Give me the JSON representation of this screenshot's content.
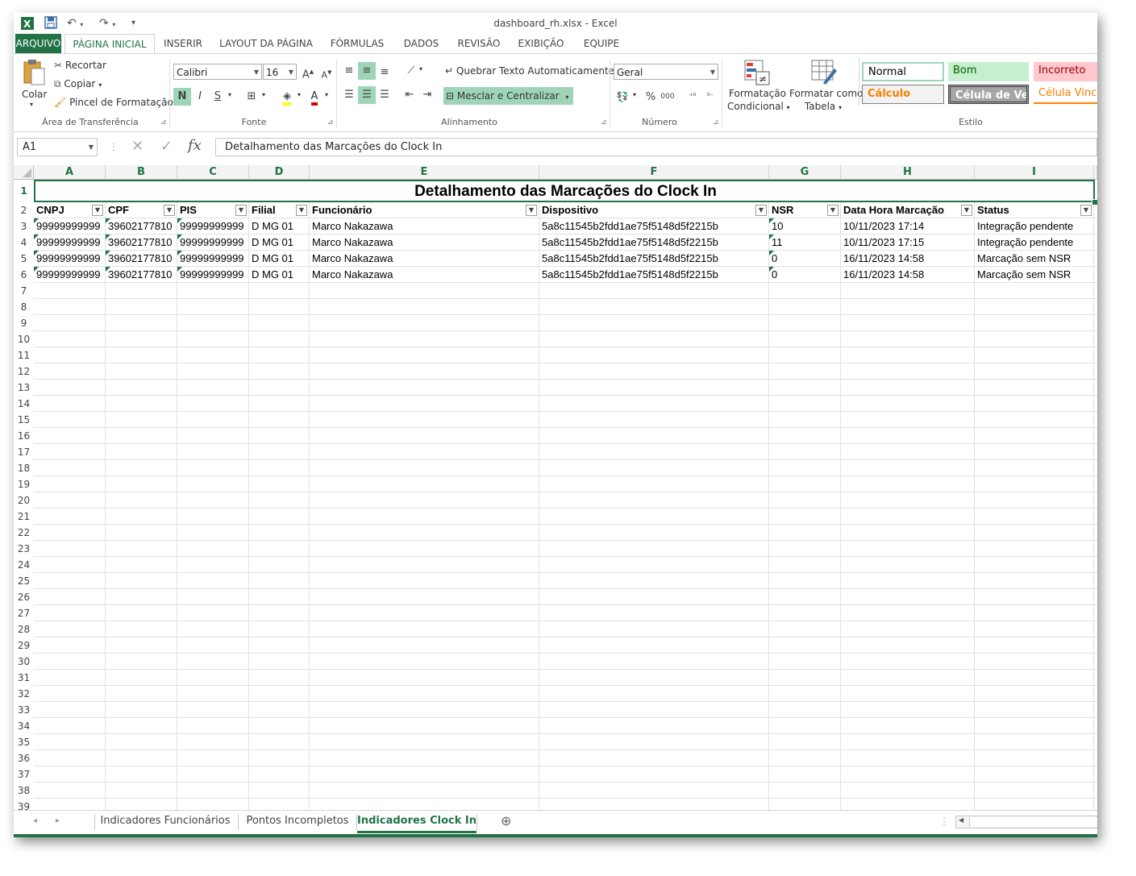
{
  "window": {
    "title": "dashboard_rh.xlsx - Excel"
  },
  "quick_access": {
    "app_icon": "excel-icon",
    "save_icon": "save-icon",
    "undo_icon": "undo-icon",
    "redo_icon": "redo-icon",
    "customize_icon": "customize-icon"
  },
  "ribbon_tabs": [
    "ARQUIVO",
    "PÁGINA INICIAL",
    "INSERIR",
    "LAYOUT DA PÁGINA",
    "FÓRMULAS",
    "DADOS",
    "REVISÃO",
    "EXIBIÇÃO",
    "EQUIPE"
  ],
  "clipboard": {
    "paste_label": "Colar",
    "cut_label": "Recortar",
    "copy_label": "Copiar",
    "format_painter_label": "Pincel de Formatação",
    "group_label": "Área de Transferência"
  },
  "font": {
    "name": "Calibri",
    "size": "16",
    "bold_label": "N",
    "italic_label": "I",
    "underline_label": "S",
    "group_label": "Fonte"
  },
  "alignment": {
    "wrap_label": "Quebrar Texto Automaticamente",
    "merge_label": "Mesclar e Centralizar",
    "group_label": "Alinhamento"
  },
  "number": {
    "format": "Geral",
    "percent_label": "%",
    "thousands_label": "000",
    "group_label": "Número"
  },
  "styles": {
    "conditional_label_1": "Formatação",
    "conditional_label_2": "Condicional",
    "table_label_1": "Formatar como",
    "table_label_2": "Tabela",
    "cells": {
      "normal": "Normal",
      "bom": "Bom",
      "incorreto": "Incorreto",
      "calculo": "Cálculo",
      "celula_verif": "Célula de Ve...",
      "celula_vinc": "Célula Vincu"
    },
    "group_label": "Estilo"
  },
  "formula_bar": {
    "name_box": "A1",
    "fx_label": "fx",
    "content": "Detalhamento das Marcações do Clock In"
  },
  "sheet": {
    "columns": [
      "A",
      "B",
      "C",
      "D",
      "E",
      "F",
      "G",
      "H",
      "I"
    ],
    "title": "Detalhamento das Marcações do Clock In",
    "headers": [
      "CNPJ",
      "CPF",
      "PIS",
      "Filial",
      "Funcionário",
      "Dispositivo",
      "NSR",
      "Data Hora Marcação",
      "Status"
    ],
    "rows": [
      [
        "99999999999",
        "39602177810",
        "99999999999",
        "D MG 01",
        "Marco Nakazawa",
        "5a8c11545b2fdd1ae75f5148d5f2215b",
        "10",
        "10/11/2023 17:14",
        "Integração pendente"
      ],
      [
        "99999999999",
        "39602177810",
        "99999999999",
        "D MG 01",
        "Marco Nakazawa",
        "5a8c11545b2fdd1ae75f5148d5f2215b",
        "11",
        "10/11/2023 17:15",
        "Integração pendente"
      ],
      [
        "99999999999",
        "39602177810",
        "99999999999",
        "D MG 01",
        "Marco Nakazawa",
        "5a8c11545b2fdd1ae75f5148d5f2215b",
        "0",
        "16/11/2023 14:58",
        "Marcação sem NSR"
      ],
      [
        "99999999999",
        "39602177810",
        "99999999999",
        "D MG 01",
        "Marco Nakazawa",
        "5a8c11545b2fdd1ae75f5148d5f2215b",
        "0",
        "16/11/2023 14:58",
        "Marcação sem NSR"
      ]
    ],
    "row_numbers": [
      "1",
      "2",
      "3",
      "4",
      "5",
      "6",
      "7",
      "8",
      "9",
      "10",
      "11",
      "12",
      "13",
      "14",
      "15",
      "16",
      "17",
      "18",
      "19",
      "20",
      "21",
      "22",
      "23",
      "24",
      "25",
      "26",
      "27",
      "28",
      "29",
      "30",
      "31",
      "32",
      "33",
      "34",
      "35",
      "36",
      "37",
      "38",
      "39"
    ]
  },
  "sheet_tabs": [
    "Indicadores Funcionários",
    "Pontos Incompletos",
    "Indicadores Clock In"
  ],
  "active_sheet": "Indicadores Clock In",
  "colors": {
    "excel_green": "#217346",
    "bom_bg": "#c6efce",
    "bom_fg": "#006100",
    "incorreto_bg": "#ffc7ce",
    "incorreto_fg": "#9c0006",
    "calculo_bg": "#f2f2f2",
    "calculo_fg": "#fa7d00",
    "verif_bg": "#a5a5a5"
  }
}
